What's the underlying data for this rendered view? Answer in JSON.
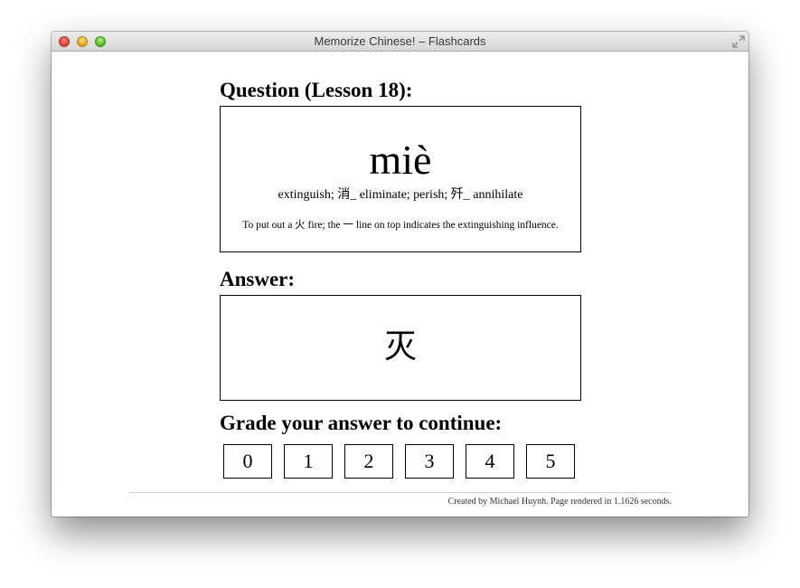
{
  "window": {
    "title": "Memorize Chinese! – Flashcards"
  },
  "question": {
    "heading": "Question (Lesson 18):",
    "pinyin": "miè",
    "meaning": "extinguish; 消_ eliminate; perish; 歼_ annihilate",
    "note": "To put out a 火 fire; the 一 line on top indicates the extinguishing influence."
  },
  "answer": {
    "heading": "Answer:",
    "character": "灭"
  },
  "grading": {
    "heading": "Grade your answer to continue:",
    "options": [
      "0",
      "1",
      "2",
      "3",
      "4",
      "5"
    ]
  },
  "footer": {
    "text": "Created by Michael Huynh. Page rendered in 1.1626 seconds."
  },
  "icons": {
    "close": "close-button-icon",
    "minimize": "minimize-button-icon",
    "zoom": "zoom-button-icon",
    "fullscreen": "fullscreen-arrows-icon"
  }
}
